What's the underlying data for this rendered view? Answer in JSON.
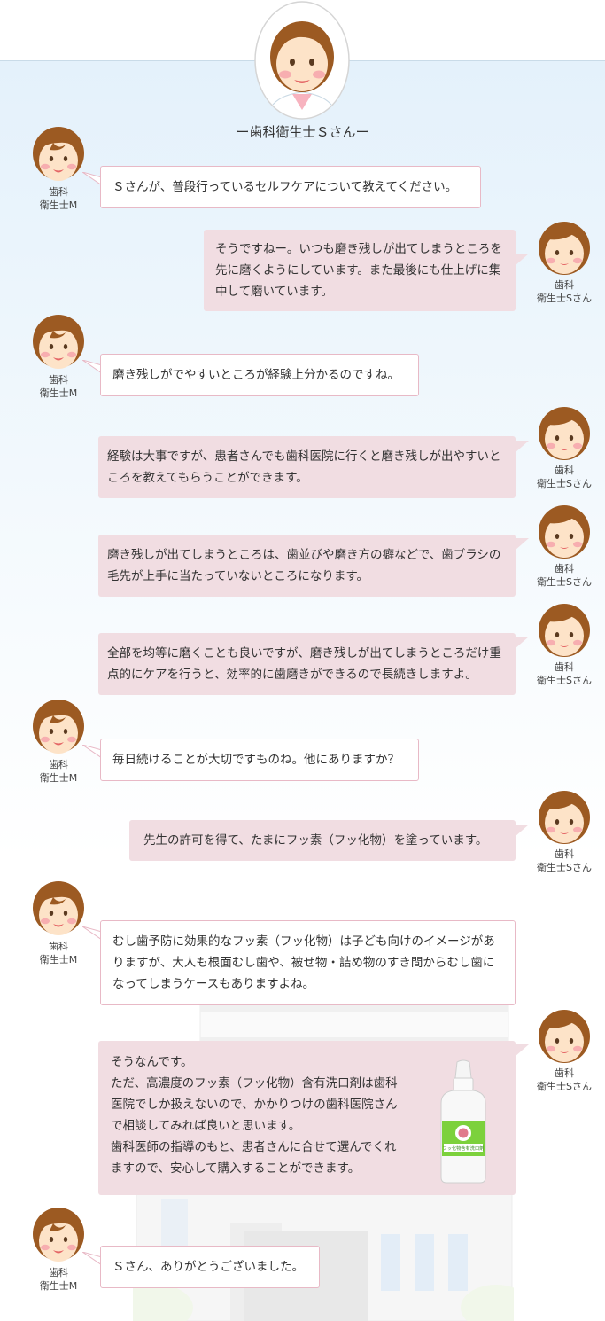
{
  "header": {
    "caption": "ー歯科衛生士Ｓさんー"
  },
  "labels": {
    "interviewer_line1": "歯科",
    "interviewer_line2": "衛生士M",
    "hygienist_line1": "歯科",
    "hygienist_line2": "衛生士Sさん"
  },
  "dialogue": [
    "Ｓさんが、普段行っているセルフケアについて教えてください。",
    "そうですねー。いつも磨き残しが出てしまうところを先に磨くようにしています。また最後にも仕上げに集中して磨いています。",
    "磨き残しがでやすいところが経験上分かるのですね。",
    "経験は大事ですが、患者さんでも歯科医院に行くと磨き残しが出やすいところを教えてもらうことができます。",
    "磨き残しが出てしまうところは、歯並びや磨き方の癖などで、歯ブラシの毛先が上手に当たっていないところになります。",
    "全部を均等に磨くことも良いですが、磨き残しが出てしまうところだけ重点的にケアを行うと、効率的に歯磨きができるので長続きしますよ。",
    "毎日続けることが大切ですものね。他にありますか？",
    "先生の許可を得て、たまにフッ素（フッ化物）を塗っています。",
    "むし歯予防に効果的なフッ素（フッ化物）は子ども向けのイメージがありますが、大人も根面むし歯や、被せ物・詰め物のすき間からむし歯になってしまうケースもありますよね。",
    [
      "そうなんです。",
      "ただ、高濃度のフッ素（フッ化物）含有洗口剤は歯科医院でしか扱えないので、かかりつけの歯科医院さんで相談してみれば良いと思います。",
      "歯科医師の指導のもと、患者さんに合せて選んでくれますので、安心して購入することができます。"
    ],
    "Ｓさん、ありがとうございました。"
  ],
  "bottle_label": "フッ化物含有洗口剤",
  "colors": {
    "panel_top": "#e4f1fb",
    "bubble_s_bg": "#f1dde2",
    "bubble_m_border": "#e8b9c6",
    "hair": "#9c5a22",
    "skin": "#fde3c8",
    "cheek": "#f7aeb0"
  }
}
